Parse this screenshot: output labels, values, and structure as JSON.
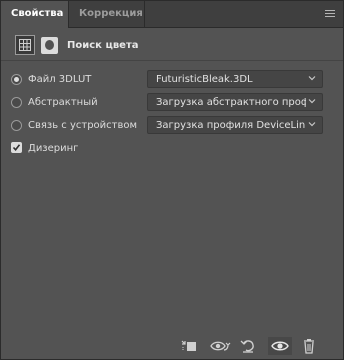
{
  "tabs": [
    {
      "label": "Свойства",
      "active": true
    },
    {
      "label": "Коррекция",
      "active": false
    }
  ],
  "header": {
    "title": "Поиск цвета"
  },
  "options": [
    {
      "label": "Файл 3DLUT",
      "selected": true,
      "value": "FuturisticBleak.3DL"
    },
    {
      "label": "Абстрактный",
      "selected": false,
      "value": "Загрузка абстрактного профи..."
    },
    {
      "label": "Связь с устройством",
      "selected": false,
      "value": "Загрузка профиля DeviceLink..."
    }
  ],
  "dither": {
    "label": "Дизеринг",
    "checked": true
  },
  "footer_icons": [
    "clip-to-layer-icon",
    "view-previous-state-icon",
    "reset-icon",
    "visibility-eye-icon",
    "trash-icon"
  ]
}
